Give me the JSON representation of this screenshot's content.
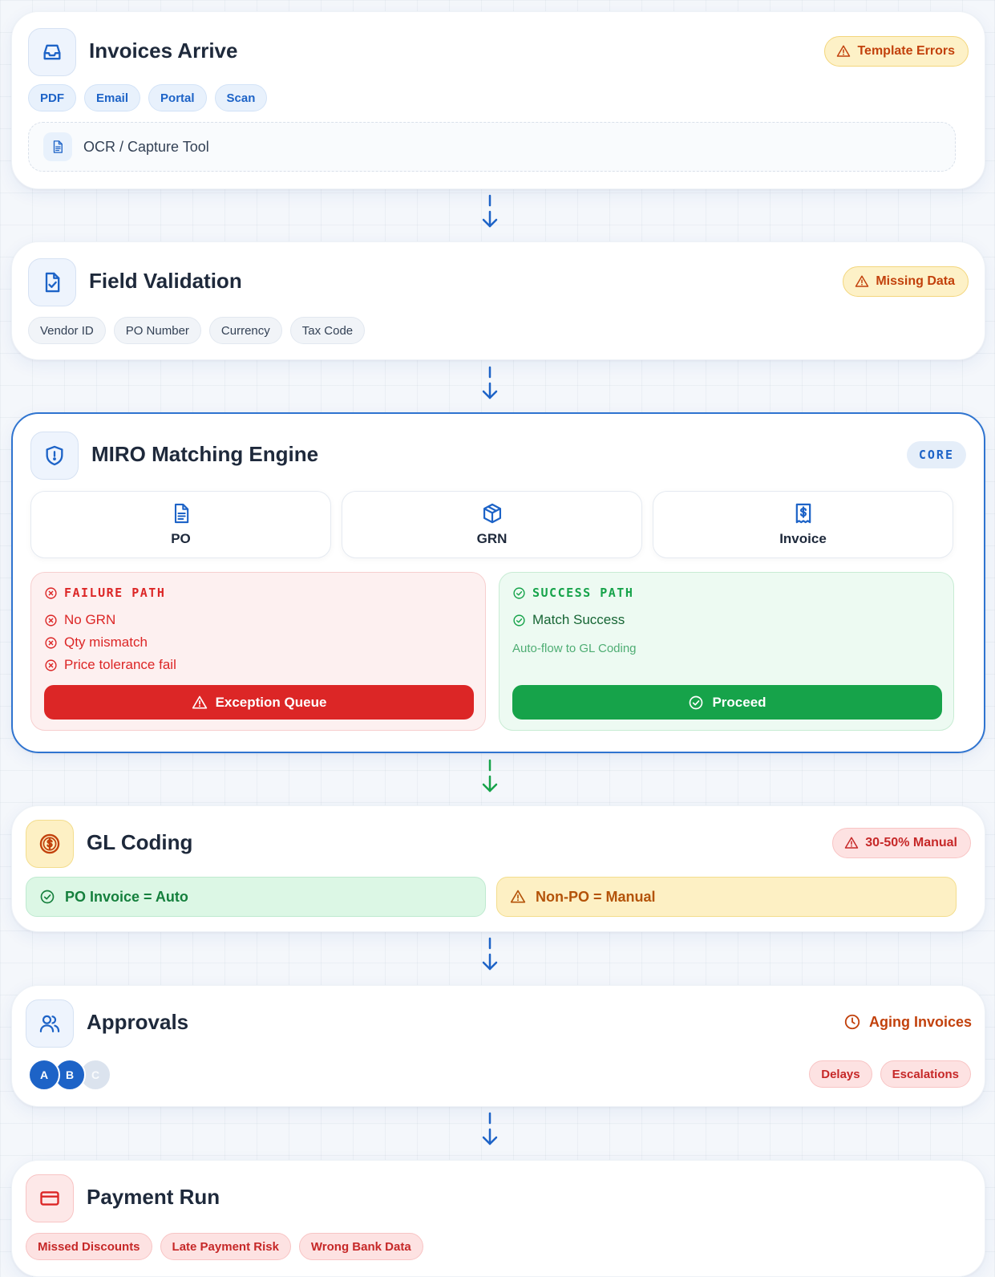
{
  "colors": {
    "primary_blue": "#1d63c7",
    "warning_bg": "#fdf1c7",
    "warning_text": "#c2410c",
    "danger": "#dc2626",
    "success": "#16a34a",
    "coin_orange": "#c2410c"
  },
  "stages": {
    "invoices": {
      "title": "Invoices Arrive",
      "icon": "inbox-icon",
      "badge": "Template Errors",
      "chips": [
        "PDF",
        "Email",
        "Portal",
        "Scan"
      ],
      "tool": "OCR / Capture Tool",
      "tool_icon": "document-icon"
    },
    "validation": {
      "title": "Field Validation",
      "icon": "file-check-icon",
      "badge": "Missing Data",
      "chips": [
        "Vendor ID",
        "PO Number",
        "Currency",
        "Tax Code"
      ]
    },
    "miro": {
      "title": "MIRO Matching Engine",
      "icon": "shield-icon",
      "core_label": "CORE",
      "documents": [
        {
          "label": "PO",
          "icon": "document-icon"
        },
        {
          "label": "GRN",
          "icon": "package-icon"
        },
        {
          "label": "Invoice",
          "icon": "receipt-icon"
        }
      ],
      "failure": {
        "title": "FAILURE PATH",
        "items": [
          "No GRN",
          "Qty mismatch",
          "Price tolerance fail"
        ],
        "button": "Exception Queue"
      },
      "success": {
        "title": "SUCCESS PATH",
        "item": "Match Success",
        "note": "Auto-flow to GL Coding",
        "button": "Proceed"
      }
    },
    "gl": {
      "title": "GL Coding",
      "icon": "coin-icon",
      "badge": "30-50% Manual",
      "auto": "PO Invoice = Auto",
      "manual": "Non-PO = Manual"
    },
    "approvals": {
      "title": "Approvals",
      "icon": "users-icon",
      "aging": "Aging Invoices",
      "avatars": [
        "A",
        "B",
        "C"
      ],
      "tags": [
        "Delays",
        "Escalations"
      ]
    },
    "payment": {
      "title": "Payment Run",
      "icon": "credit-card-icon",
      "tags": [
        "Missed Discounts",
        "Late Payment Risk",
        "Wrong Bank Data"
      ]
    }
  }
}
